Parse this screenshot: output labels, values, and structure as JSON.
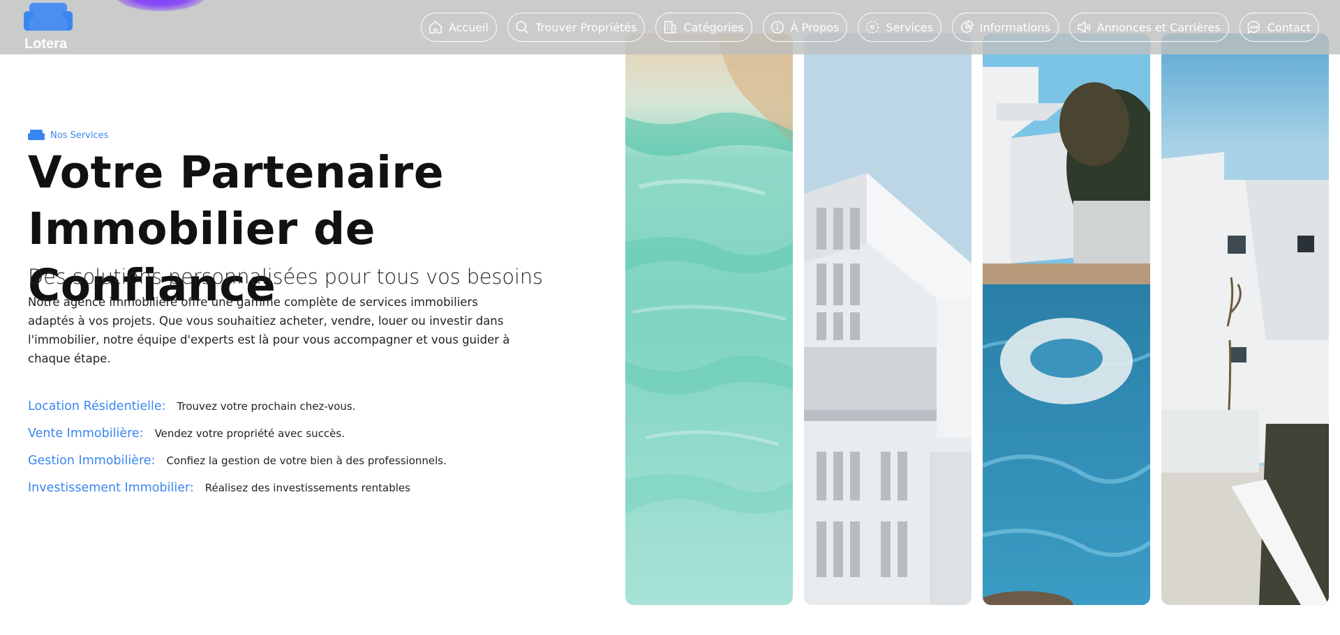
{
  "brand": {
    "name": "Lotera",
    "icon": "sofa-icon",
    "color": "#3a86f0"
  },
  "nav": [
    {
      "label": "Accueil",
      "icon": "home-icon"
    },
    {
      "label": "Trouver Propriétés",
      "icon": "search-icon"
    },
    {
      "label": "Catégories",
      "icon": "building-icon"
    },
    {
      "label": "À Propos",
      "icon": "info-icon"
    },
    {
      "label": "Services",
      "icon": "services-icon"
    },
    {
      "label": "Informations",
      "icon": "pie-chart-icon"
    },
    {
      "label": "Annonces et Carrières",
      "icon": "megaphone-icon"
    },
    {
      "label": "Contact",
      "icon": "chat-icon"
    }
  ],
  "hero": {
    "badge": "Nos Services",
    "title_line1": "Votre Partenaire",
    "title_line2": "Immobilier de Confiance",
    "subtitle": "Des solutions personnalisées pour tous vos besoins",
    "description": "Notre agence immobilière offre une gamme complète de services immobiliers adaptés à vos projets. Que vous souhaitiez acheter, vendre, louer ou investir dans l'immobilier, notre équipe d'experts est là pour vous accompagner et vous guider à chaque étape."
  },
  "services": [
    {
      "title": "Location Résidentielle:",
      "desc": "Trouvez votre prochain chez-vous."
    },
    {
      "title": "Vente Immobilière:",
      "desc": "Vendez votre propriété avec succès."
    },
    {
      "title": "Gestion Immobilière:",
      "desc": "Confiez la gestion de votre bien à des professionnels."
    },
    {
      "title": "Investissement Immobilier:",
      "desc": "Réalisez des investissements rentables"
    }
  ],
  "images": [
    "pool-water-photo",
    "white-building-photo",
    "pool-float-photo",
    "white-house-photo"
  ]
}
